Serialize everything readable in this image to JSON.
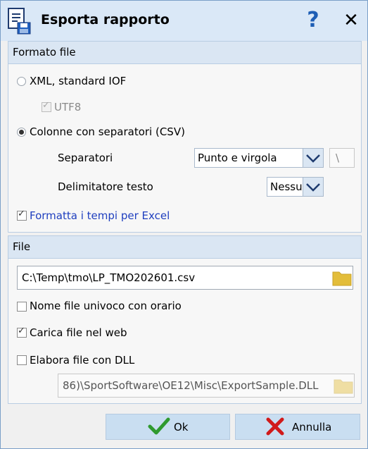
{
  "window": {
    "title": "Esporta rapporto"
  },
  "icons": {
    "app": "export-document-icon",
    "help": "help-question-icon",
    "close": "close-icon",
    "folder": "folder-icon",
    "ok": "check-icon",
    "cancel": "cross-icon"
  },
  "help_label": "?",
  "close_label": "✕",
  "format_group": {
    "header": "Formato file",
    "xml_label": "XML, standard IOF",
    "xml_selected": false,
    "utf8_label": "UTF8",
    "utf8_checked": true,
    "utf8_enabled": false,
    "csv_label": "Colonne con separatori (CSV)",
    "csv_selected": true,
    "separators_label": "Separatori",
    "separators_value": "Punto e virgola",
    "separator_char": "\\",
    "delimiter_label": "Delimitatore testo",
    "delimiter_value": "Nessun",
    "excel_label": "Formatta i tempi per Excel",
    "excel_checked": true
  },
  "file_group": {
    "header": "File",
    "path_value": "C:\\Temp\\tmo\\LP_TMO202601.csv",
    "unique_label": "Nome file univoco con orario",
    "unique_checked": false,
    "upload_label": "Carica file nel web",
    "upload_checked": true,
    "dll_label": "Elabora file con DLL",
    "dll_checked": false,
    "dll_path": "86)\\SportSoftware\\OE12\\Misc\\ExportSample.DLL"
  },
  "buttons": {
    "ok_label": "Ok",
    "cancel_label": "Annulla"
  },
  "colors": {
    "title_bg": "#dae8f7",
    "group_header_bg": "#dae6f3",
    "link_blue": "#1f3fbf",
    "button_bg": "#c9def1",
    "ok_green": "#2f9a2f",
    "cancel_red": "#d11a1a",
    "folder_yellow": "#e3bd3a"
  }
}
